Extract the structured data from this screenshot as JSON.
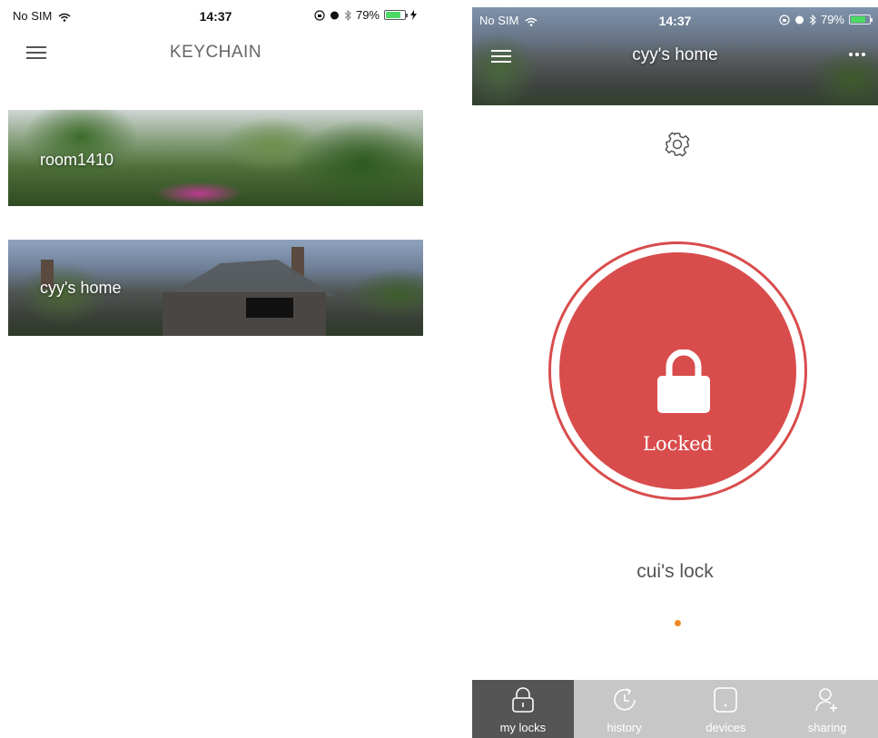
{
  "left": {
    "status": {
      "carrier": "No SIM",
      "time": "14:37",
      "battery": "79%"
    },
    "nav_title": "KEYCHAIN",
    "cards": [
      {
        "label": "room1410"
      },
      {
        "label": "cyy's home"
      }
    ]
  },
  "right": {
    "status": {
      "carrier": "No SIM",
      "time": "14:37",
      "battery": "79%"
    },
    "header_title": "cyy's home",
    "lock_state": "Locked",
    "lock_name": "cui's lock",
    "tabs": [
      {
        "label": "my locks",
        "icon": "lock-icon"
      },
      {
        "label": "history",
        "icon": "history-icon"
      },
      {
        "label": "devices",
        "icon": "device-icon"
      },
      {
        "label": "sharing",
        "icon": "add-user-icon"
      }
    ]
  },
  "colors": {
    "lock_red": "#d94c4c",
    "page_dot": "#f08a24",
    "tab_active": "#555555",
    "tab_bar": "#c7c7c7",
    "battery": "#4cd964"
  },
  "battery_level": 0.79
}
